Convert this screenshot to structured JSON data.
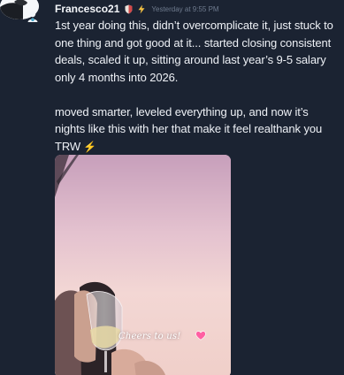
{
  "message": {
    "username": "Francesco21",
    "timestamp": "Yesterday at 9:55 PM",
    "role_icon": "role-badge-icon",
    "badges": [
      "shield-icon",
      "bolt-icon"
    ],
    "paragraph_1": "1st year doing this, didn’t overcomplicate it, just stuck to one thing and got good at it... started closing consistent deals, scaled it up, sitting around last year’s 9-5 salary only 4 months into 2026.",
    "paragraph_2": "moved smarter, leveled everything up, and now it’s nights like this with her that make it feel realthank you TRW",
    "paragraph_2_emoji": "⚡",
    "attachment": {
      "caption": "Cheers to us!",
      "caption_icon": "heart-icon"
    }
  },
  "colors": {
    "background": "#1b2332",
    "username": "#f5f7fb",
    "timestamp": "#6f7b8e",
    "body_text": "#eef1f6",
    "bolt": "#f6c343",
    "heart": "#ff5fa2"
  }
}
